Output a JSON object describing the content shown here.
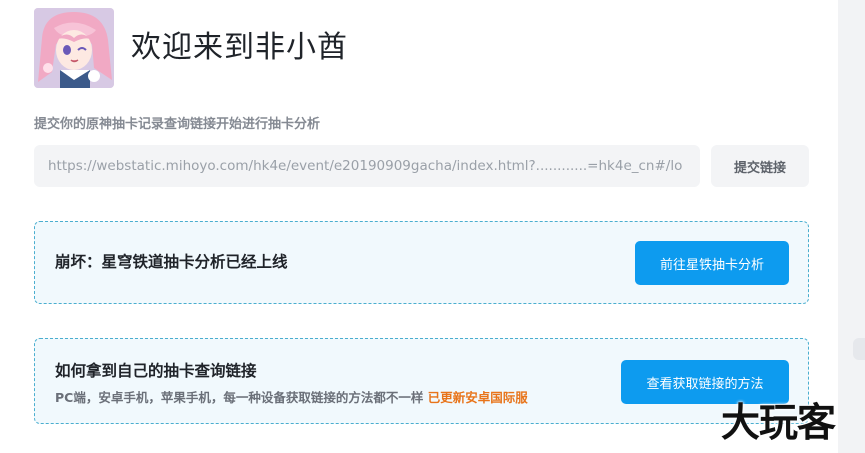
{
  "header": {
    "title": "欢迎来到非小酋"
  },
  "submit": {
    "prompt": "提交你的原神抽卡记录查询链接开始进行抽卡分析",
    "url_value": "https://webstatic.mihoyo.com/hk4e/event/e20190909gacha/index.html?............=hk4e_cn#/lo",
    "button_label": "提交链接"
  },
  "notices": {
    "starrail": {
      "title": "崩坏：星穹铁道抽卡分析已经上线",
      "button_label": "前往星铁抽卡分析"
    },
    "howto": {
      "title": "如何拿到自己的抽卡查询链接",
      "desc": "PC端，安卓手机，苹果手机，每一种设备获取链接的方法都不一样",
      "highlight": "已更新安卓国际服",
      "button_label": "查看获取链接的方法"
    }
  },
  "watermark": "大玩客",
  "colors": {
    "accent": "#0d9bef",
    "notice_border": "#4aaecf",
    "notice_bg": "#f1f9fd",
    "highlight": "#e8741a"
  },
  "icons": {
    "avatar": "anime-girl-avatar"
  }
}
